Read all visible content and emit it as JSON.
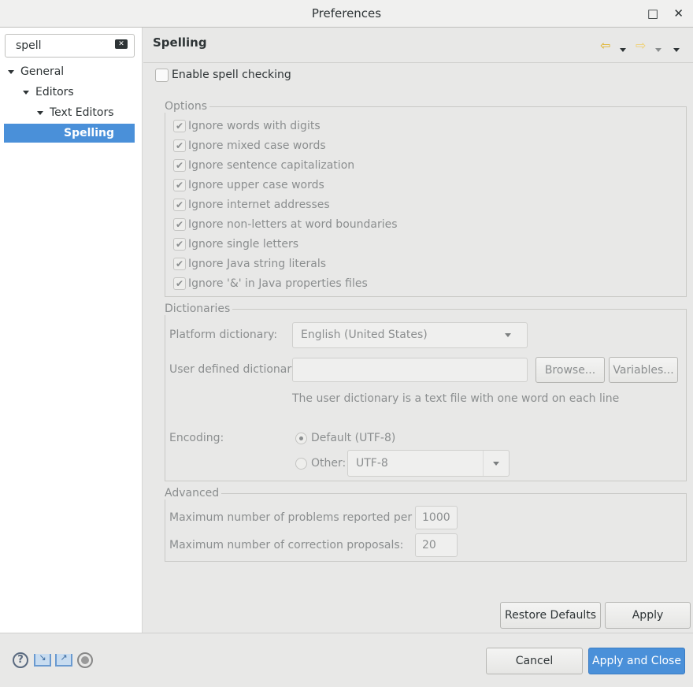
{
  "window": {
    "title": "Preferences",
    "maximize": "□",
    "close": "✕"
  },
  "sidebar": {
    "search_value": "spell",
    "tree": [
      {
        "label": "General"
      },
      {
        "label": "Editors"
      },
      {
        "label": "Text Editors"
      },
      {
        "label": "Spelling"
      }
    ]
  },
  "page": {
    "title": "Spelling",
    "enable_label": "Enable spell checking",
    "options": {
      "title": "Options",
      "items": [
        "Ignore words with digits",
        "Ignore mixed case words",
        "Ignore sentence capitalization",
        "Ignore upper case words",
        "Ignore internet addresses",
        "Ignore non-letters at word boundaries",
        "Ignore single letters",
        "Ignore Java string literals",
        "Ignore '&' in Java properties files"
      ]
    },
    "dictionaries": {
      "title": "Dictionaries",
      "platform_label": "Platform dictionary:",
      "platform_value": "English (United States)",
      "user_label": "User defined dictionary:",
      "user_value": "",
      "browse": "Browse...",
      "variables": "Variables...",
      "hint": "The user dictionary is a text file with one word on each line",
      "encoding_label": "Encoding:",
      "default_label": "Default (UTF-8)",
      "other_label": "Other:",
      "other_value": "UTF-8"
    },
    "advanced": {
      "title": "Advanced",
      "max_problems_label": "Maximum number of problems reported per file:",
      "max_problems": "1000",
      "max_proposals_label": "Maximum number of correction proposals:",
      "max_proposals": "20"
    },
    "restore": "Restore Defaults",
    "apply": "Apply"
  },
  "footer": {
    "cancel": "Cancel",
    "apply_close": "Apply and Close"
  },
  "colors": {
    "accent": "#4a90d9",
    "nav_arrow": "#f0c040"
  }
}
